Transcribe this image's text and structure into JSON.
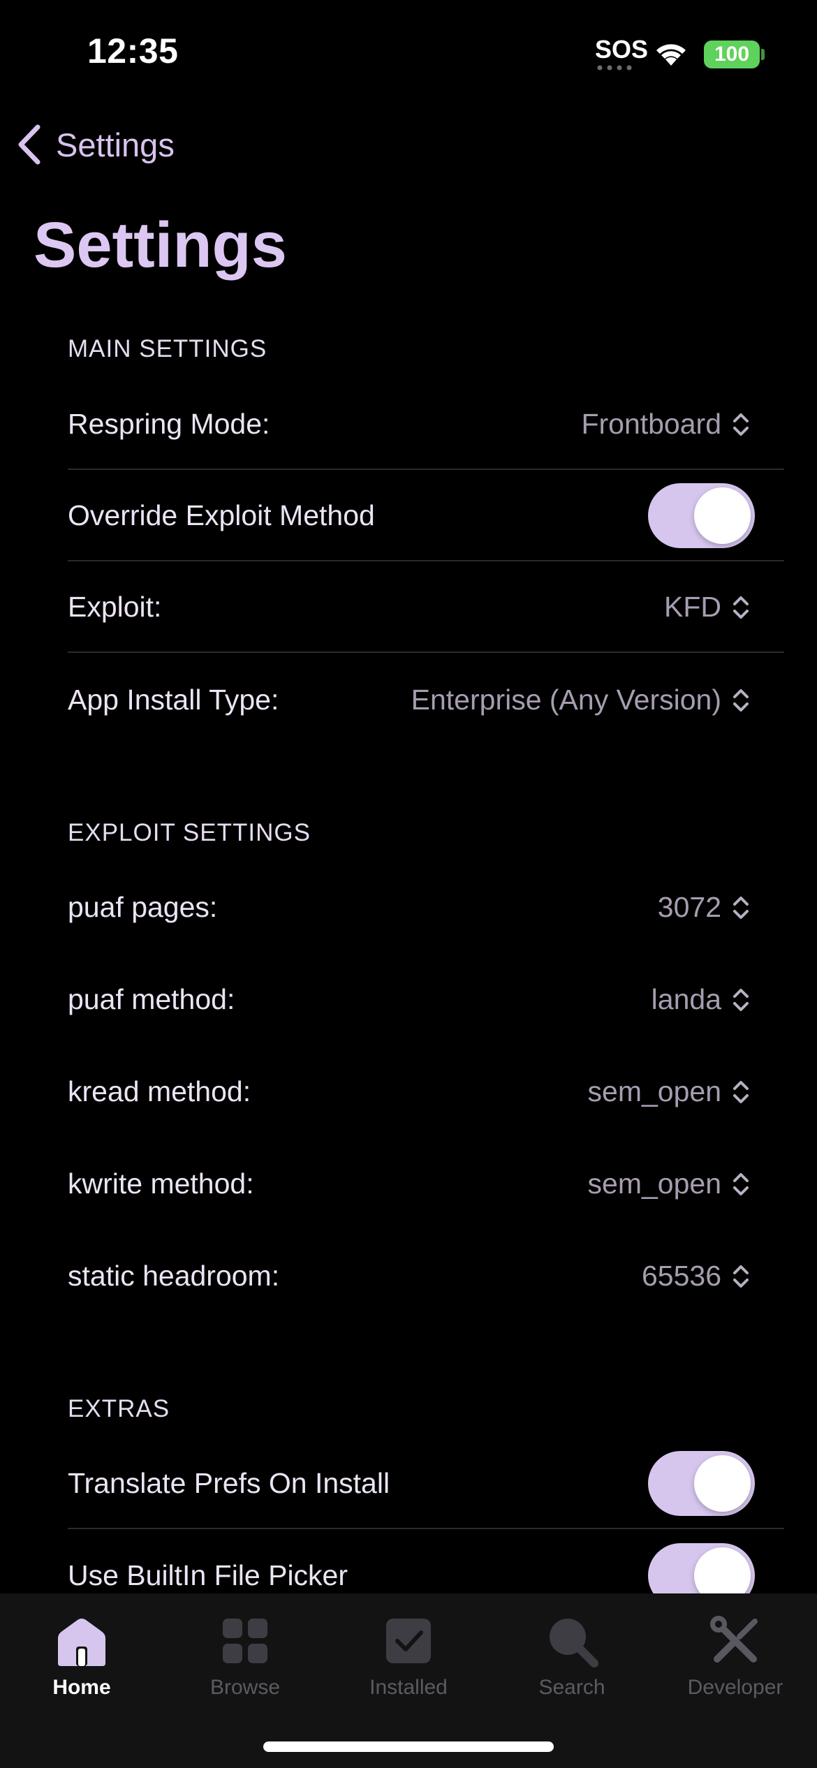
{
  "status_bar": {
    "time": "12:35",
    "sos": "SOS",
    "battery": "100",
    "battery_color": "#5ed25a"
  },
  "nav": {
    "back_label": "Settings",
    "title": "Settings"
  },
  "accent_color": "#dcc7f2",
  "sections": {
    "main": {
      "header": "MAIN SETTINGS",
      "respring_label": "Respring Mode:",
      "respring_value": "Frontboard",
      "override_label": "Override Exploit Method",
      "override_on": true,
      "exploit_label": "Exploit:",
      "exploit_value": "KFD",
      "install_label": "App Install Type:",
      "install_value": "Enterprise (Any Version)"
    },
    "exploit": {
      "header": "EXPLOIT SETTINGS",
      "puaf_pages_label": "puaf pages:",
      "puaf_pages_value": "3072",
      "puaf_method_label": "puaf method:",
      "puaf_method_value": "landa",
      "kread_label": "kread method:",
      "kread_value": "sem_open",
      "kwrite_label": "kwrite method:",
      "kwrite_value": "sem_open",
      "headroom_label": "static headroom:",
      "headroom_value": "65536"
    },
    "extras": {
      "header": "EXTRAS",
      "translate_label": "Translate Prefs On Install",
      "translate_on": true,
      "picker_label": "Use BuiltIn File Picker",
      "picker_on": true
    }
  },
  "tab_bar": {
    "tabs": [
      {
        "label": "Home",
        "icon": "house-icon",
        "active": true
      },
      {
        "label": "Browse",
        "icon": "grid-icon",
        "active": false
      },
      {
        "label": "Installed",
        "icon": "checkmark-square-icon",
        "active": false
      },
      {
        "label": "Search",
        "icon": "magnifier-icon",
        "active": false
      },
      {
        "label": "Developer",
        "icon": "wrench-screwdriver-icon",
        "active": false
      }
    ]
  }
}
